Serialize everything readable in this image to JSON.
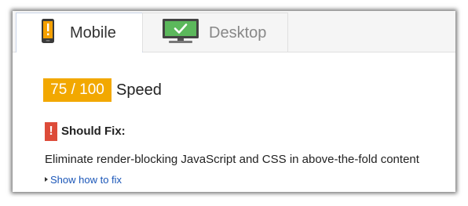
{
  "tabs": {
    "mobile": {
      "label": "Mobile",
      "icon": "phone-warning-icon",
      "active": true
    },
    "desktop": {
      "label": "Desktop",
      "icon": "monitor-check-icon",
      "active": false
    }
  },
  "score": {
    "value": "75 / 100",
    "label": "Speed",
    "color": "#f2a800"
  },
  "should_fix": {
    "icon_text": "!",
    "label": "Should Fix:",
    "color": "#dd4b39"
  },
  "rule": {
    "text": "Eliminate render-blocking JavaScript and CSS in above-the-fold content"
  },
  "show_link": {
    "label": "Show how to fix",
    "color": "#1a56b8"
  }
}
